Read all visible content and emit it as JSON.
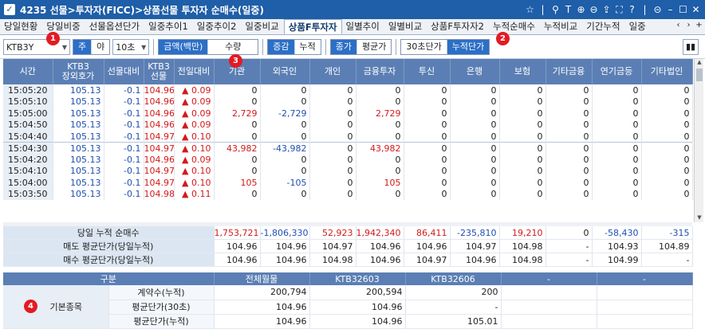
{
  "window": {
    "title": "4235 선물>투자자(FICC)>상품선물 투자자 순매수(일중)",
    "icons": [
      "star-icon",
      "divider",
      "pin-icon",
      "text-icon",
      "zoom-in-icon",
      "zoom-out-icon",
      "share-icon",
      "fullscreen-icon",
      "help-icon",
      "minimize-icon",
      "restore-icon",
      "close-icon"
    ]
  },
  "tabs": [
    {
      "label": "당일현황"
    },
    {
      "label": "당일비중"
    },
    {
      "label": "선물옵션단가"
    },
    {
      "label": "일중추이1"
    },
    {
      "label": "일중추이2"
    },
    {
      "label": "일중비교"
    },
    {
      "label": "상품F투자자"
    },
    {
      "label": "일별추이"
    },
    {
      "label": "일별비교"
    },
    {
      "label": "상품F투자자2"
    },
    {
      "label": "누적순매수"
    },
    {
      "label": "누적비교"
    },
    {
      "label": "기간누적"
    },
    {
      "label": "일중"
    }
  ],
  "active_tab": "상품F투자자",
  "toolbar": {
    "symbol": "KTB3Y",
    "day_night": [
      "주",
      "야"
    ],
    "interval": "10초",
    "amount_qty": [
      "금액(백만)",
      "수량"
    ],
    "change_cum": [
      "증감",
      "누적"
    ],
    "close_avg": [
      "종가",
      "평균가"
    ],
    "unit_cum": [
      "30초단가",
      "누적단가"
    ]
  },
  "badges": [
    "1",
    "2",
    "3",
    "4"
  ],
  "columns": [
    "시간",
    "KTB3\n장외호가",
    "선물대비",
    "KTB3\n선물",
    "전일대비",
    "기관",
    "외국인",
    "개인",
    "금융투자",
    "투신",
    "은행",
    "보험",
    "기타금융",
    "연기금등",
    "기타법인"
  ],
  "rows": [
    [
      "15:05:20",
      "105.13",
      "-0.1",
      "104.96",
      "▲ 0.09",
      "0",
      "0",
      "0",
      "0",
      "0",
      "0",
      "0",
      "0",
      "0",
      "0"
    ],
    [
      "15:05:10",
      "105.13",
      "-0.1",
      "104.96",
      "▲ 0.09",
      "0",
      "0",
      "0",
      "0",
      "0",
      "0",
      "0",
      "0",
      "0",
      "0"
    ],
    [
      "15:05:00",
      "105.13",
      "-0.1",
      "104.96",
      "▲ 0.09",
      "2,729",
      "-2,729",
      "0",
      "2,729",
      "0",
      "0",
      "0",
      "0",
      "0",
      "0"
    ],
    [
      "15:04:50",
      "105.13",
      "-0.1",
      "104.96",
      "▲ 0.09",
      "0",
      "0",
      "0",
      "0",
      "0",
      "0",
      "0",
      "0",
      "0",
      "0"
    ],
    [
      "15:04:40",
      "105.13",
      "-0.1",
      "104.97",
      "▲ 0.10",
      "0",
      "0",
      "0",
      "0",
      "0",
      "0",
      "0",
      "0",
      "0",
      "0"
    ],
    [
      "15:04:30",
      "105.13",
      "-0.1",
      "104.97",
      "▲ 0.10",
      "43,982",
      "-43,982",
      "0",
      "43,982",
      "0",
      "0",
      "0",
      "0",
      "0",
      "0"
    ],
    [
      "15:04:20",
      "105.13",
      "-0.1",
      "104.96",
      "▲ 0.09",
      "0",
      "0",
      "0",
      "0",
      "0",
      "0",
      "0",
      "0",
      "0",
      "0"
    ],
    [
      "15:04:10",
      "105.13",
      "-0.1",
      "104.97",
      "▲ 0.10",
      "0",
      "0",
      "0",
      "0",
      "0",
      "0",
      "0",
      "0",
      "0",
      "0"
    ],
    [
      "15:04:00",
      "105.13",
      "-0.1",
      "104.97",
      "▲ 0.10",
      "105",
      "-105",
      "0",
      "105",
      "0",
      "0",
      "0",
      "0",
      "0",
      "0"
    ],
    [
      "15:03:50",
      "105.13",
      "-0.1",
      "104.98",
      "▲ 0.11",
      "0",
      "0",
      "0",
      "0",
      "0",
      "0",
      "0",
      "0",
      "0",
      "0"
    ]
  ],
  "summary": [
    {
      "label": "당일 누적 순매수",
      "values": [
        "1,753,721",
        "-1,806,330",
        "52,923",
        "1,942,340",
        "86,411",
        "-235,810",
        "19,210",
        "0",
        "-58,430",
        "-315"
      ]
    },
    {
      "label": "매도 평균단가(당일누적)",
      "values": [
        "104.96",
        "104.96",
        "104.97",
        "104.96",
        "104.96",
        "104.97",
        "104.98",
        "-",
        "104.93",
        "104.89"
      ]
    },
    {
      "label": "매수 평균단가(당일누적)",
      "values": [
        "104.96",
        "104.96",
        "104.98",
        "104.96",
        "104.97",
        "104.96",
        "104.98",
        "-",
        "104.99",
        "-"
      ]
    }
  ],
  "base": {
    "headers": [
      "구분",
      "전체월물",
      "KTB32603",
      "KTB32606",
      "-",
      "-"
    ],
    "group_label": "기본종목",
    "rows": [
      {
        "label": "계약수(누적)",
        "values": [
          "200,794",
          "200,594",
          "200",
          "",
          ""
        ]
      },
      {
        "label": "평균단가(30초)",
        "values": [
          "104.96",
          "104.96",
          "-",
          "",
          ""
        ]
      },
      {
        "label": "평균단가(누적)",
        "values": [
          "104.96",
          "104.96",
          "105.01",
          "",
          ""
        ]
      }
    ]
  },
  "colors": {
    "header": "#5b7fb4",
    "title": "#1f5ea8",
    "accent": "#2c6fc6",
    "up": "#d21a1a",
    "down": "#1f4fb0",
    "badge": "#e21b23"
  }
}
